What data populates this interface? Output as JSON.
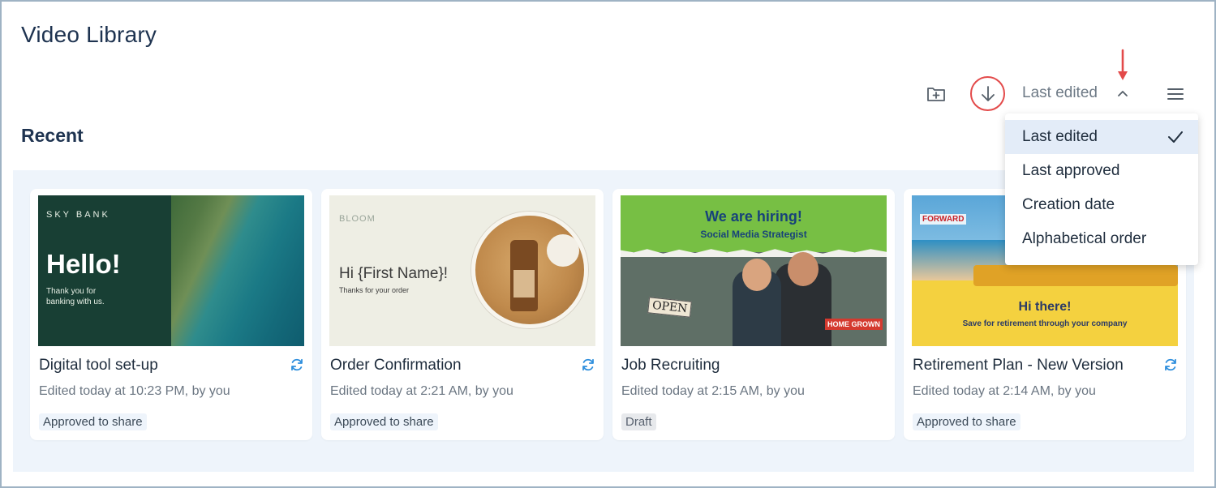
{
  "page": {
    "title": "Video Library",
    "section_title": "Recent"
  },
  "toolbar": {
    "new_folder_icon": "folder-plus-icon",
    "download_icon": "arrow-down-circle-icon",
    "sort_label": "Last edited",
    "sort_toggle_icon": "chevron-up-icon",
    "menu_icon": "hamburger-menu-icon"
  },
  "sort_menu": {
    "items": [
      {
        "label": "Last edited",
        "selected": true
      },
      {
        "label": "Last approved",
        "selected": false
      },
      {
        "label": "Creation date",
        "selected": false
      },
      {
        "label": "Alphabetical order",
        "selected": false
      }
    ]
  },
  "cards": [
    {
      "title": "Digital tool set-up",
      "meta": "Edited today at 10:23 PM, by you",
      "status": "Approved to share",
      "sync_icon": true,
      "thumb": {
        "brand": "SKY BANK",
        "headline": "Hello!",
        "subline": "Thank you for banking with us."
      }
    },
    {
      "title": "Order Confirmation",
      "meta": "Edited today at 2:21 AM, by you",
      "status": "Approved to share",
      "sync_icon": true,
      "thumb": {
        "brand": "BLOOM",
        "headline": "Hi {First Name}!",
        "subline": "Thanks for your order"
      }
    },
    {
      "title": "Job Recruiting",
      "meta": "Edited today at 2:15 AM, by you",
      "status": "Draft",
      "sync_icon": false,
      "thumb": {
        "headline": "We are hiring!",
        "subline": "Social Media Strategist",
        "sign": "OPEN",
        "tag": "HOME GROWN"
      }
    },
    {
      "title": "Retirement Plan - New Version",
      "meta": "Edited today at 2:14 AM, by you",
      "status": "Approved to share",
      "sync_icon": true,
      "thumb": {
        "brand": "FORWARD",
        "headline": "Hi there!",
        "subline": "Save for retirement through your company"
      }
    }
  ],
  "colors": {
    "accent_red": "#e34a4a",
    "grid_background": "#eef4fb",
    "selected_item": "#e3ecf8",
    "sync_blue": "#2f8fdd"
  }
}
